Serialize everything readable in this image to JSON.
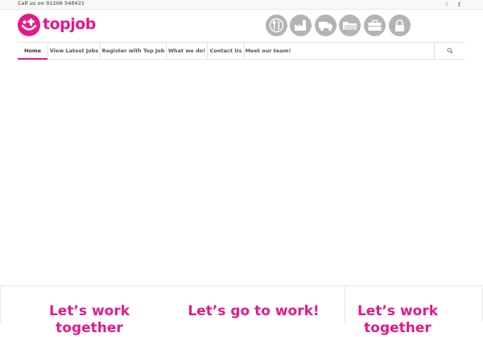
{
  "topbar": {
    "phone": "Call us on 01206 548421",
    "social": {
      "twitter": "t",
      "facebook": "f"
    }
  },
  "logo": {
    "text": "topjob",
    "icon": "smiley-logo-icon",
    "brand_color": "#e5198a"
  },
  "categories": [
    {
      "icon": "fork-knife-icon"
    },
    {
      "icon": "factory-icon"
    },
    {
      "icon": "truck-icon"
    },
    {
      "icon": "folder-icon"
    },
    {
      "icon": "briefcase-icon"
    },
    {
      "icon": "padlock-icon"
    }
  ],
  "nav": {
    "items": [
      {
        "label": "Home",
        "active": true
      },
      {
        "label": "View Latest Jobs"
      },
      {
        "label": "Register with Top Job"
      },
      {
        "label": "What we do!"
      },
      {
        "label": "Contact Us"
      },
      {
        "label": "Meet our team!"
      }
    ],
    "search_icon": "search-icon"
  },
  "columns": [
    {
      "headline_line1": "Let’s work",
      "headline_line2": "together"
    },
    {
      "headline_line1": "Let’s go to work!"
    },
    {
      "headline_line1": "Let’s work",
      "headline_line2": "together"
    }
  ],
  "colors": {
    "accent": "#e5198a",
    "icon_grey": "#b4b4b4",
    "border": "#e3e3e3"
  }
}
